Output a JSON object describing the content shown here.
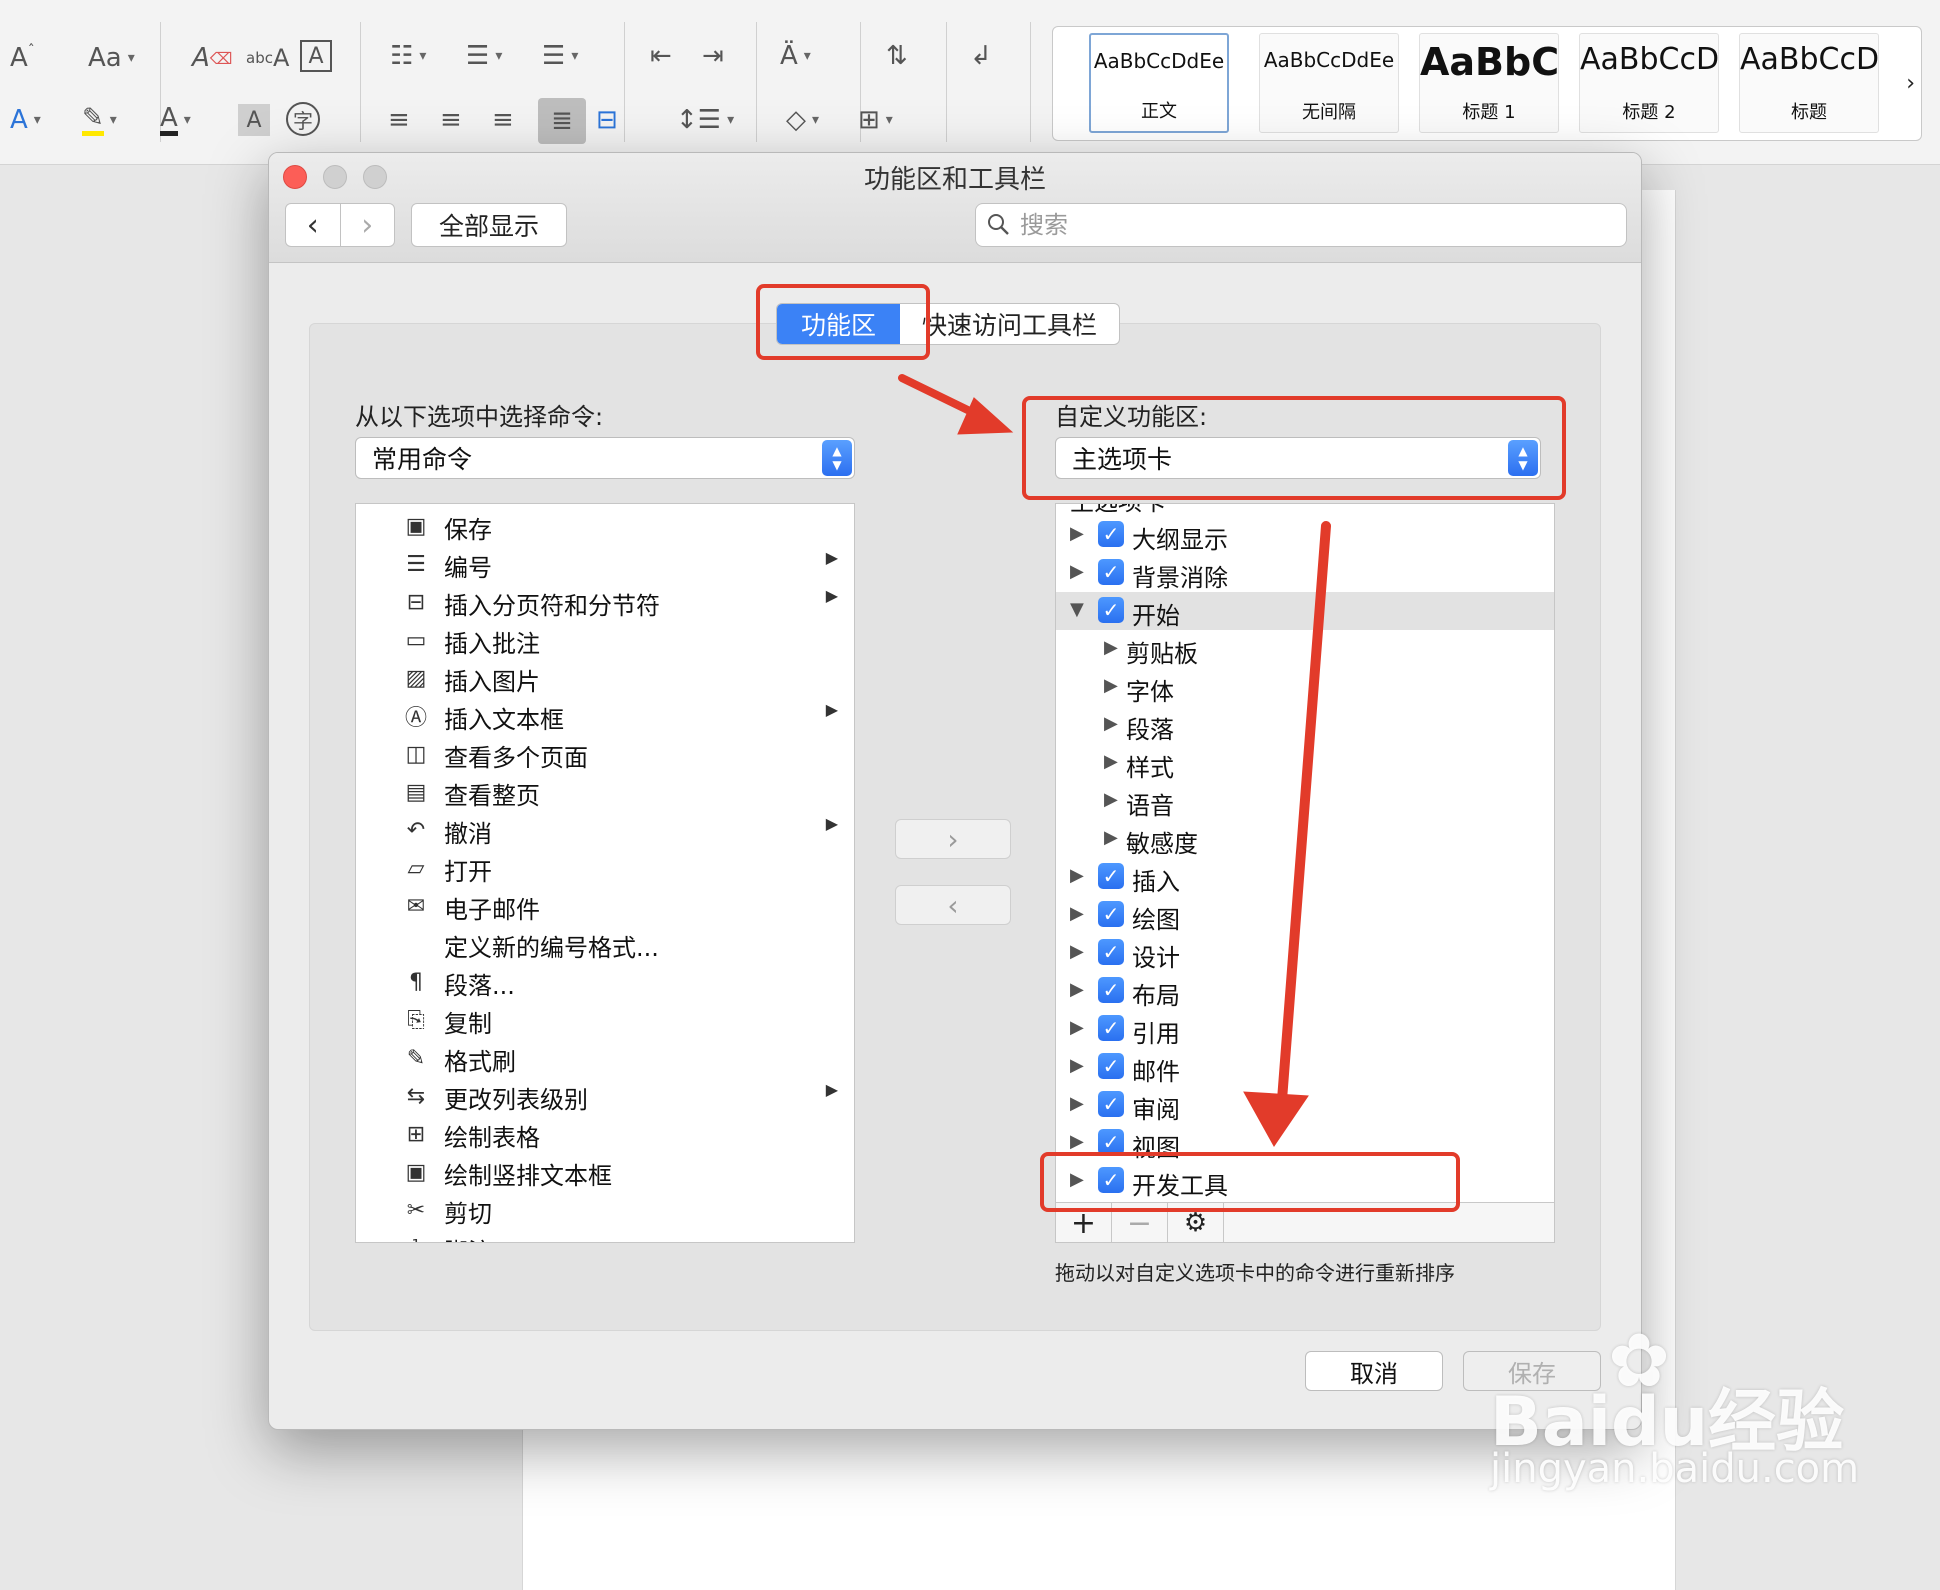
{
  "ribbon": {
    "font_size_up": "A",
    "change_case": "Aa",
    "font_color_letter": "A",
    "phonetic_label": "字",
    "styles": [
      {
        "sample": "AaBbCcDdEe",
        "name": "正文"
      },
      {
        "sample": "AaBbCcDdEe",
        "name": "无间隔"
      },
      {
        "sample": "AaBbC",
        "name": "标题 1"
      },
      {
        "sample": "AaBbCcD",
        "name": "标题 2"
      },
      {
        "sample": "AaBbCcD",
        "name": "标题"
      }
    ],
    "gallery_next": "›"
  },
  "dialog": {
    "title": "功能区和工具栏",
    "show_all": "全部显示",
    "search_placeholder": "搜索",
    "tabs": [
      "功能区",
      "快速访问工具栏"
    ],
    "choose_label": "从以下选项中选择命令:",
    "choose_value": "常用命令",
    "customize_label": "自定义功能区:",
    "customize_value": "主选项卡",
    "commands": [
      {
        "label": "保存",
        "icon": "save-icon",
        "glyph": "▣"
      },
      {
        "label": "编号",
        "icon": "numbering-icon",
        "glyph": "☰",
        "submenu": true
      },
      {
        "label": "插入分页符和分节符",
        "icon": "page-break-icon",
        "glyph": "⊟",
        "submenu": true
      },
      {
        "label": "插入批注",
        "icon": "comment-icon",
        "glyph": "▭"
      },
      {
        "label": "插入图片",
        "icon": "picture-icon",
        "glyph": "▨"
      },
      {
        "label": "插入文本框",
        "icon": "text-box-icon",
        "glyph": "Ⓐ",
        "submenu": true
      },
      {
        "label": "查看多个页面",
        "icon": "multiple-pages-icon",
        "glyph": "◫"
      },
      {
        "label": "查看整页",
        "icon": "one-page-icon",
        "glyph": "▤"
      },
      {
        "label": "撤消",
        "icon": "undo-icon",
        "glyph": "↶",
        "submenu": true
      },
      {
        "label": "打开",
        "icon": "open-folder-icon",
        "glyph": "▱"
      },
      {
        "label": "电子邮件",
        "icon": "email-icon",
        "glyph": "✉"
      },
      {
        "label": "定义新的编号格式...",
        "icon": "",
        "glyph": ""
      },
      {
        "label": "段落...",
        "icon": "paragraph-icon",
        "glyph": "¶"
      },
      {
        "label": "复制",
        "icon": "copy-icon",
        "glyph": "⎘"
      },
      {
        "label": "格式刷",
        "icon": "format-painter-icon",
        "glyph": "✎"
      },
      {
        "label": "更改列表级别",
        "icon": "list-level-icon",
        "glyph": "⇆",
        "submenu": true
      },
      {
        "label": "绘制表格",
        "icon": "draw-table-icon",
        "glyph": "⊞"
      },
      {
        "label": "绘制竖排文本框",
        "icon": "vertical-text-box-icon",
        "glyph": "▣"
      },
      {
        "label": "剪切",
        "icon": "cut-icon",
        "glyph": "✂"
      },
      {
        "label": "脚注",
        "icon": "footnote-icon",
        "glyph": "¹"
      }
    ],
    "add_arrow": "›",
    "remove_arrow": "‹",
    "tree_partial_header": "主选项卡",
    "tree": [
      {
        "label": "大纲显示",
        "level": 0,
        "checked": true,
        "open": false
      },
      {
        "label": "背景消除",
        "level": 0,
        "checked": true,
        "open": false
      },
      {
        "label": "开始",
        "level": 0,
        "checked": true,
        "open": true
      },
      {
        "label": "剪贴板",
        "level": 1
      },
      {
        "label": "字体",
        "level": 1
      },
      {
        "label": "段落",
        "level": 1
      },
      {
        "label": "样式",
        "level": 1
      },
      {
        "label": "语音",
        "level": 1
      },
      {
        "label": "敏感度",
        "level": 1
      },
      {
        "label": "插入",
        "level": 0,
        "checked": true,
        "open": false
      },
      {
        "label": "绘图",
        "level": 0,
        "checked": true,
        "open": false
      },
      {
        "label": "设计",
        "level": 0,
        "checked": true,
        "open": false
      },
      {
        "label": "布局",
        "level": 0,
        "checked": true,
        "open": false
      },
      {
        "label": "引用",
        "level": 0,
        "checked": true,
        "open": false
      },
      {
        "label": "邮件",
        "level": 0,
        "checked": true,
        "open": false
      },
      {
        "label": "审阅",
        "level": 0,
        "checked": true,
        "open": false
      },
      {
        "label": "视图",
        "level": 0,
        "checked": true,
        "open": false
      },
      {
        "label": "开发工具",
        "level": 0,
        "checked": true,
        "open": false
      }
    ],
    "add_tab": "+",
    "remove_tab": "−",
    "hint": "拖动以对自定义选项卡中的命令进行重新排序",
    "cancel": "取消",
    "save": "保存"
  },
  "watermark": {
    "brand": "Baidu经验",
    "url": "jingyan.baidu.com"
  },
  "colors": {
    "accent": "#3b82f6",
    "annotation": "#e23b2a"
  }
}
